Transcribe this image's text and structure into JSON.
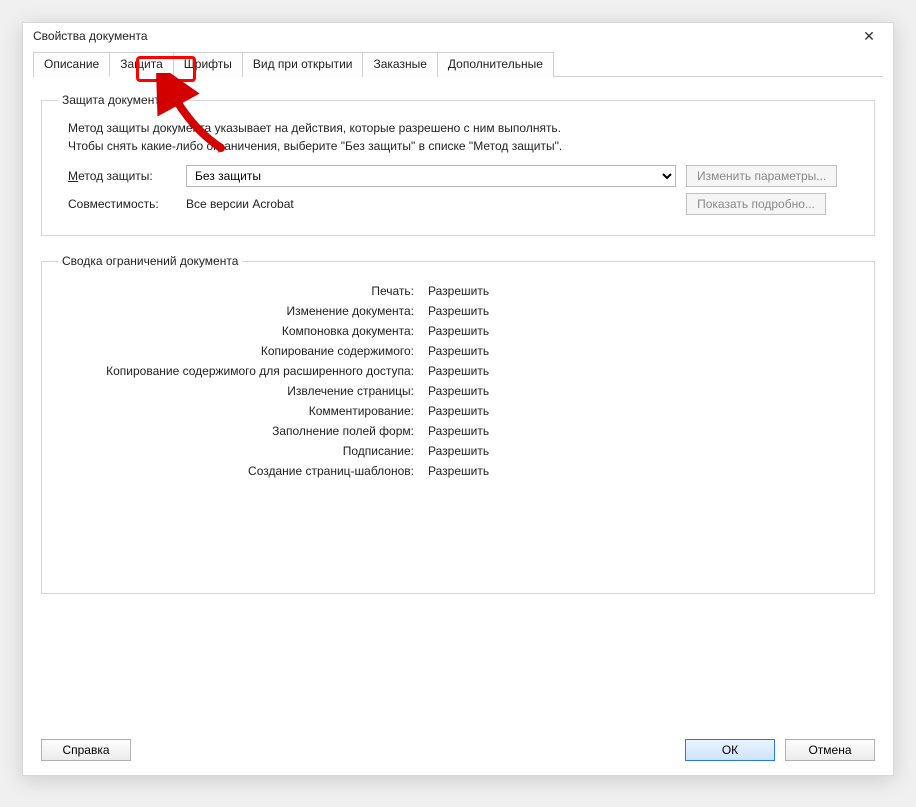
{
  "window": {
    "title": "Свойства документа",
    "close": "✕"
  },
  "tabs": {
    "items": [
      {
        "label": "Описание"
      },
      {
        "label": "Защита"
      },
      {
        "label": "Шрифты"
      },
      {
        "label": "Вид при открытии"
      },
      {
        "label": "Заказные"
      },
      {
        "label": "Дополнительные"
      }
    ],
    "active_index": 1
  },
  "security_group": {
    "legend": "Защита документа",
    "description_line1": "Метод защиты документа указывает на действия, которые разрешено с ним выполнять.",
    "description_line2": "Чтобы снять какие-либо ограничения, выберите \"Без защиты\" в списке \"Метод защиты\".",
    "method_label_pre": "М",
    "method_label_post": "етод защиты:",
    "method_value": "Без защиты",
    "change_params_button": "Изменить параметры...",
    "compat_label": "Совместимость:",
    "compat_value": "Все версии Acrobat",
    "show_details_button": "Показать подробно..."
  },
  "restrictions_group": {
    "legend": "Сводка ограничений документа",
    "rows": [
      {
        "label": "Печать:",
        "value": "Разрешить"
      },
      {
        "label": "Изменение документа:",
        "value": "Разрешить"
      },
      {
        "label": "Компоновка документа:",
        "value": "Разрешить"
      },
      {
        "label": "Копирование содержимого:",
        "value": "Разрешить"
      },
      {
        "label": "Копирование содержимого для расширенного доступа:",
        "value": "Разрешить"
      },
      {
        "label": "Извлечение страницы:",
        "value": "Разрешить"
      },
      {
        "label": "Комментирование:",
        "value": "Разрешить"
      },
      {
        "label": "Заполнение полей форм:",
        "value": "Разрешить"
      },
      {
        "label": "Подписание:",
        "value": "Разрешить"
      },
      {
        "label": "Создание страниц-шаблонов:",
        "value": "Разрешить"
      }
    ]
  },
  "footer": {
    "help": "Справка",
    "ok": "ОК",
    "cancel": "Отмена"
  }
}
